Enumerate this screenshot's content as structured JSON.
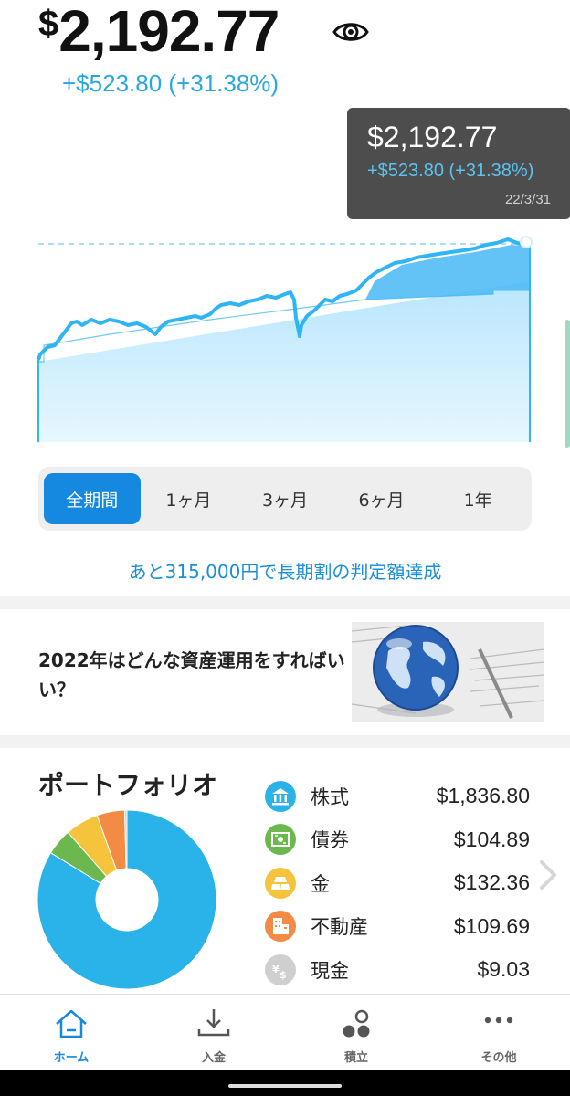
{
  "header": {
    "currency_symbol": "$",
    "balance": "2,192.77",
    "gain": "+$523.80 (+31.38%)"
  },
  "tooltip": {
    "amount": "$2,192.77",
    "gain": "+$523.80 (+31.38%)",
    "date": "22/3/31"
  },
  "periods": [
    {
      "label": "全期間",
      "active": true
    },
    {
      "label": "1ヶ月",
      "active": false
    },
    {
      "label": "3ヶ月",
      "active": false
    },
    {
      "label": "6ヶ月",
      "active": false
    },
    {
      "label": "1年",
      "active": false
    }
  ],
  "target_message": "あと315,000円で長期割の判定額達成",
  "article": {
    "title": "2022年はどんな資産運用をすればいい？",
    "thumbnail_icon": "globe-on-newspaper-image"
  },
  "portfolio": {
    "title": "ポートフォリオ",
    "items": [
      {
        "label": "株式",
        "value": "$1,836.80",
        "color": "#29b3e8",
        "icon": "bank-icon"
      },
      {
        "label": "債券",
        "value": "$104.89",
        "color": "#6cb84e",
        "icon": "bond-certificate-icon"
      },
      {
        "label": "金",
        "value": "$132.36",
        "color": "#f6c33c",
        "icon": "gold-bars-icon"
      },
      {
        "label": "不動産",
        "value": "$109.69",
        "color": "#f28c45",
        "icon": "building-icon"
      },
      {
        "label": "現金",
        "value": "$9.03",
        "color": "#cfcfcf",
        "icon": "yen-dollar-coin-icon"
      }
    ],
    "donut_shares": [
      1836.8,
      104.89,
      132.36,
      109.69,
      9.03
    ]
  },
  "nav": [
    {
      "label": "ホーム",
      "icon": "home-icon",
      "active": true
    },
    {
      "label": "入金",
      "icon": "deposit-download-icon",
      "active": false
    },
    {
      "label": "積立",
      "icon": "accumulation-dots-icon",
      "active": false
    },
    {
      "label": "その他",
      "icon": "more-dots-icon",
      "active": false
    }
  ],
  "colors": {
    "accent": "#1588e0",
    "gain": "#29a8e0",
    "chart_line": "#2fb4f4",
    "chart_fill": "#cfeefe"
  }
}
